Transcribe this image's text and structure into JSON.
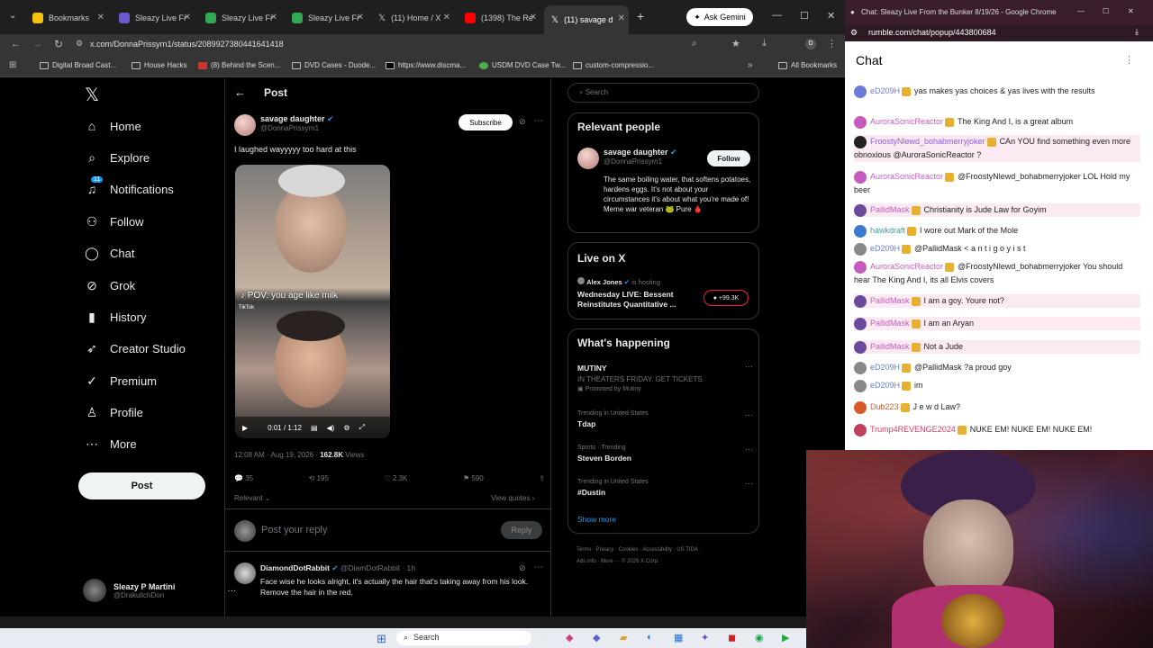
{
  "browser": {
    "tabs": [
      {
        "label": "Bookmarks",
        "color": "#f4c20d"
      },
      {
        "label": "Sleazy Live Fr",
        "color": "#6a5acd"
      },
      {
        "label": "Sleazy Live Fr",
        "color": "#34a853"
      },
      {
        "label": "Sleazy Live Fr",
        "color": "#34a853"
      },
      {
        "label": "(11) Home / X",
        "color": "#ffffff"
      },
      {
        "label": "(1398) The Re",
        "color": "#ff0000"
      },
      {
        "label": "(11) savage d",
        "color": "#ffffff"
      }
    ],
    "ask_gemini": "Ask Gemini",
    "url": "x.com/DonnaPrissyrn1/status/2089927380441641418",
    "bookmarks": [
      "Digital Broad Cast...",
      "House Hacks",
      "(8) Behind the Scen...",
      "DVD Cases - Duode...",
      "https://www.discma...",
      "USDM DVD Case Tw...",
      "custom-compressio...",
      "All Bookmarks"
    ]
  },
  "x": {
    "nav": [
      "Home",
      "Explore",
      "Notifications",
      "Follow",
      "Chat",
      "Grok",
      "History",
      "Creator Studio",
      "Premium",
      "Profile",
      "More"
    ],
    "notif_badge": "11",
    "post_button": "Post",
    "account_name": "Sleazy P Martini",
    "account_handle": "@DrakulichDon",
    "header": "Post",
    "post": {
      "author": "savage daughter",
      "handle": "@DonnaPrissyrn1",
      "subscribe": "Subscribe",
      "text": "I laughed wayyyyy too hard at this",
      "video_caption": "POV: you age like milk",
      "video_source": "TikTok",
      "video_time": "0:01 / 1:12",
      "timestamp": "12:08 AM · Aug 19, 2026 · ",
      "views_count": "162.8K",
      "views_label": " Views",
      "replies": "35",
      "reposts": "195",
      "likes": "2.3K",
      "bookmarks": "590",
      "relevant": "Relevant",
      "view_quotes": "View quotes",
      "reply_placeholder": "Post your reply",
      "reply_button": "Reply"
    },
    "reply": {
      "author": "DiamondDotRabbit",
      "handle": "@DiamDotRabbit · 1h",
      "text1": "Face wise he looks alright, it's actually the hair that's taking away from his look.",
      "text2": "Remove the hair in the red."
    },
    "search_placeholder": "Search",
    "relevant_people": {
      "title": "Relevant people",
      "name": "savage daughter",
      "handle": "@DonnaPrissyrn1",
      "follow": "Follow",
      "bio": "The same boiling water, that softens potatoes, hardens eggs. It's not about your circumstances it's about what you're made of! Meme war veteran 🐸 Pure 🩸"
    },
    "live": {
      "title": "Live on X",
      "host": "Alex Jones",
      "hosting": "is hosting",
      "desc": "Wednesday LIVE: Bessent Reinstitutes Quantitative ...",
      "count": "+99.3K"
    },
    "happening": {
      "title": "What's happening",
      "items": [
        {
          "meta": "",
          "name": "MUTINY",
          "sub": "IN THEATERS FRIDAY. GET TICKETS.",
          "promo": "Promoted by Mutiny"
        },
        {
          "meta": "Trending in United States",
          "name": "Tdap"
        },
        {
          "meta": "Sports · Trending",
          "name": "Steven Borden"
        },
        {
          "meta": "Trending in United States",
          "name": "#Dustin"
        }
      ],
      "show_more": "Show more"
    },
    "footer": "Terms · Privacy · Cookies · Accessibility · US TIDA · Ads info · More ··· © 2026 X Corp."
  },
  "chat": {
    "window_title": "Chat: Sleazy Live From the Bunker 8/19/26 - Google Chrome",
    "url": "rumble.com/chat/popup/443800684",
    "title": "Chat",
    "messages": [
      {
        "user": "eD209H",
        "text": "yas makes yas choices & yas lives with the results",
        "color": "#6b7bd8"
      },
      {
        "user": "AuroraSonicReactor",
        "text": "The King And I, is a great album",
        "color": "#c65bbf"
      },
      {
        "user": "FroostyNlewd_bohabmerryjoker",
        "text": "CAn YOU find something even more obnoxious @AuroraSonicReactor ?",
        "color": "#8a5cf0"
      },
      {
        "user": "AuroraSonicReactor",
        "text": "@FroostyNlewd_bohabmerryjoker LOL Hold my beer",
        "color": "#c65bbf"
      },
      {
        "user": "PallidMask",
        "text": "Christianity is Jude Law for Goyim",
        "color": "#c65bbf"
      },
      {
        "user": "hawkdraft",
        "text": "I wore out Mark of the Mole",
        "color": "#3aa0a0"
      },
      {
        "user": "eD209H",
        "text": "@PallidMask < a n t i g o y i s t",
        "color": "#6b7bd8"
      },
      {
        "user": "AuroraSonicReactor",
        "text": "@FroostyNlewd_bohabmerryjoker You should hear The King And I, its all Elvis covers",
        "color": "#c65bbf"
      },
      {
        "user": "PallidMask",
        "text": "I am a goy. Youre not?",
        "color": "#c65bbf"
      },
      {
        "user": "PallidMask",
        "text": "I am an Aryan",
        "color": "#c65bbf"
      },
      {
        "user": "PallidMask",
        "text": "Not a Jude",
        "color": "#c65bbf"
      },
      {
        "user": "eD209H",
        "text": "@PallidMask ?a proud goy",
        "color": "#6b7bd8"
      },
      {
        "user": "eD209H",
        "text": "im",
        "color": "#6b7bd8"
      },
      {
        "user": "Dub223",
        "text": "J e w d Law?",
        "color": "#d65a2a"
      },
      {
        "user": "Trump4REVENGE2024",
        "text": "NUKE EM! NUKE EM! NUKE EM!",
        "color": "#d63a6a"
      }
    ]
  },
  "taskbar": {
    "search": "Search"
  }
}
